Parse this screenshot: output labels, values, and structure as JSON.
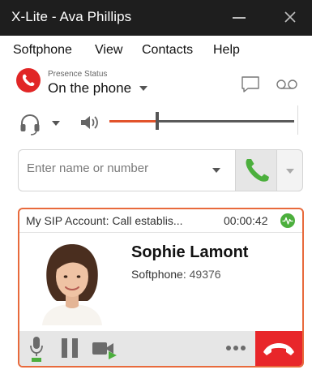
{
  "window": {
    "title": "X-Lite - Ava Phillips"
  },
  "menu": {
    "items": [
      "Softphone",
      "View",
      "Contacts",
      "Help"
    ]
  },
  "presence": {
    "label": "Presence Status",
    "status": "On the phone"
  },
  "audio": {
    "volume_percent": 26
  },
  "dial": {
    "placeholder": "Enter name or number"
  },
  "call": {
    "account": "My SIP Account: Call establis...",
    "duration": "00:00:42",
    "contact_name": "Sophie Lamont",
    "contact_type": "Softphone:",
    "contact_number": "49376"
  },
  "colors": {
    "accent": "#e86a3c",
    "hangup": "#e8262a",
    "call_green": "#4caf3d",
    "presence_red": "#e12626"
  },
  "icons": [
    "close-icon",
    "minimize-icon",
    "presence-icon",
    "chat-icon",
    "voicemail-icon",
    "headset-icon",
    "speaker-icon",
    "phone-icon",
    "signal-quality-icon",
    "microphone-icon",
    "pause-icon",
    "video-icon",
    "more-icon",
    "hangup-icon"
  ]
}
